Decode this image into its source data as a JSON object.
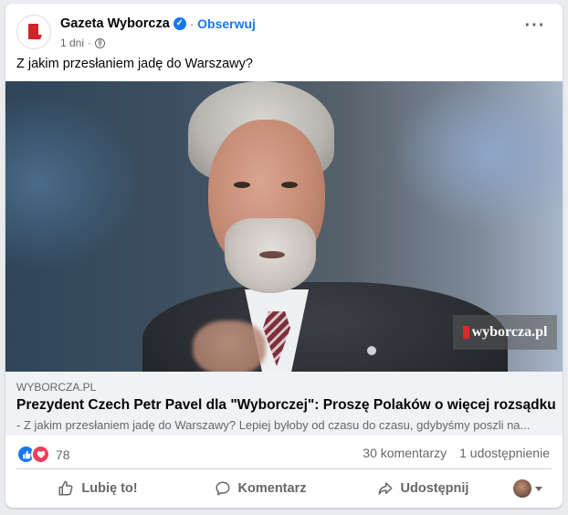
{
  "post": {
    "page_name": "Gazeta Wyborcza",
    "separator": "·",
    "follow_label": "Obserwuj",
    "time": "1 dni",
    "time_separator": "·",
    "more_label": "···",
    "text": "Z jakim przesłaniem jadę do Warszawy?"
  },
  "image": {
    "watermark": "wyborcza.pl"
  },
  "link_preview": {
    "domain": "WYBORCZA.PL",
    "headline": "Prezydent Czech Petr Pavel dla \"Wyborczej\": Proszę Polaków o więcej rozsądku",
    "description": "- Z jakim przesłaniem jadę do Warszawy? Lepiej byłoby od czasu do czasu, gdybyśmy poszli na..."
  },
  "stats": {
    "reaction_count": "78",
    "comments": "30 komentarzy",
    "shares": "1 udostępnienie"
  },
  "actions": {
    "like": "Lubię to!",
    "comment": "Komentarz",
    "share": "Udostępnij"
  },
  "colors": {
    "brand_blue": "#1877f2",
    "love_red": "#f33e58",
    "logo_red": "#d3222a"
  },
  "icons": [
    "verified-badge-icon",
    "globe-icon",
    "more-icon",
    "like-reaction-icon",
    "love-reaction-icon",
    "like-icon",
    "comment-icon",
    "share-icon",
    "chevron-down-icon"
  ]
}
